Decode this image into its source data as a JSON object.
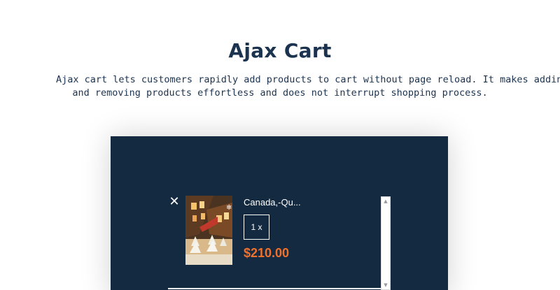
{
  "section": {
    "title": "Ajax Cart",
    "description_line1": "Ajax cart lets customers rapidly add products to cart without page reload. It makes adding",
    "description_line2": "and removing products effortless and does not interrupt shopping process."
  },
  "cart": {
    "item": {
      "remove_label": "✕",
      "name": "Canada,-Qu...",
      "quantity": "1 x",
      "price": "$210.00"
    }
  },
  "colors": {
    "heading": "#1c3350",
    "panel_bg": "#142a40",
    "price": "#f0702d"
  }
}
